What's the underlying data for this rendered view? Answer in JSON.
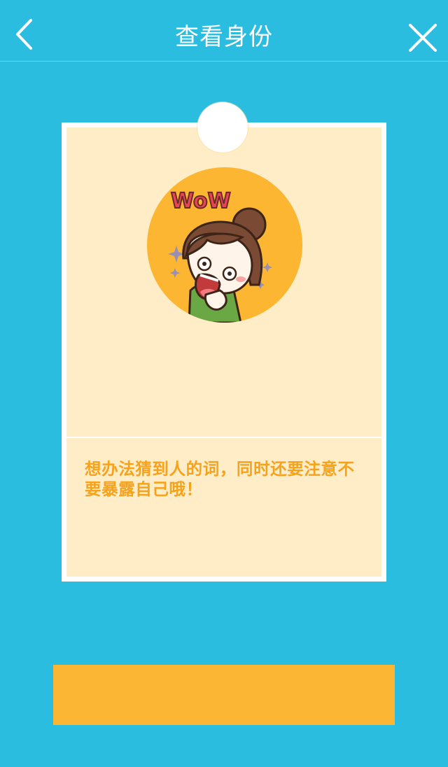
{
  "header": {
    "title": "查看身份",
    "back_icon": "chevron-left-icon",
    "close_icon": "close-icon"
  },
  "card": {
    "illustration_text": "WoW",
    "hint_text": "想办法猜到人的词，同时还要注意不要暴露自己哦！"
  },
  "colors": {
    "background": "#2bbde0",
    "card_fill": "#ffedc8",
    "accent_orange": "#fbb634",
    "hint_text": "#f7a21b"
  }
}
